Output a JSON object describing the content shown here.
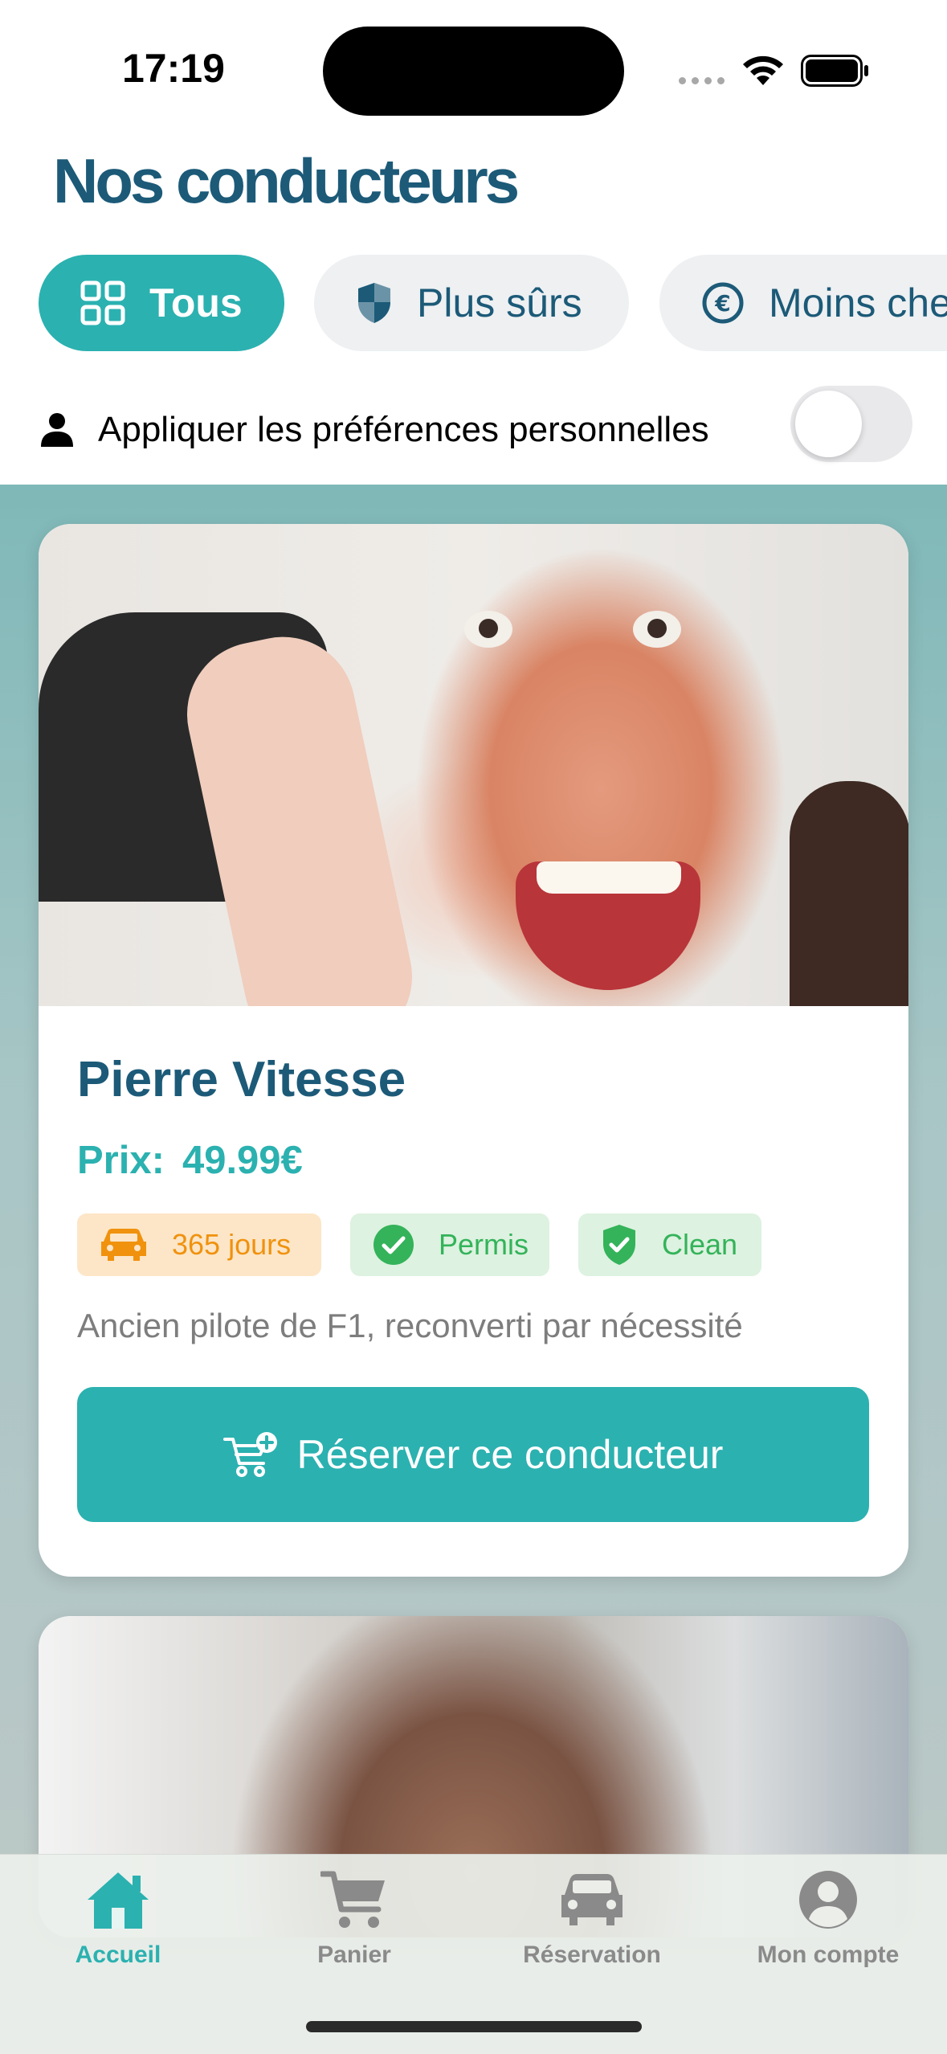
{
  "status_bar": {
    "time": "17:19"
  },
  "header": {
    "title": "Nos conducteurs"
  },
  "filters": [
    {
      "label": "Tous",
      "icon": "grid-icon",
      "active": true
    },
    {
      "label": "Plus sûrs",
      "icon": "shield-icon",
      "active": false
    },
    {
      "label": "Moins chers",
      "icon": "euro-icon",
      "active": false
    }
  ],
  "preferences": {
    "label": "Appliquer les préférences personnelles",
    "icon": "person-icon",
    "enabled": false
  },
  "drivers": [
    {
      "name": "Pierre Vitesse",
      "price_label": "Prix:",
      "price": "49.99€",
      "badges": {
        "days": "365 jours",
        "permis": "Permis",
        "clean": "Clean"
      },
      "description": "Ancien pilote de F1, reconverti par nécessité",
      "button_label": "Réserver ce conducteur"
    }
  ],
  "tab_bar": {
    "items": [
      {
        "label": "Accueil",
        "icon": "home-icon",
        "active": true
      },
      {
        "label": "Panier",
        "icon": "cart-icon",
        "active": false
      },
      {
        "label": "Réservation",
        "icon": "car-icon",
        "active": false
      },
      {
        "label": "Mon compte",
        "icon": "account-icon",
        "active": false
      }
    ]
  },
  "colors": {
    "primary": "#2bb1b0",
    "title": "#1c5a78",
    "badge_orange": "#f0920e",
    "badge_green": "#34b35a"
  }
}
